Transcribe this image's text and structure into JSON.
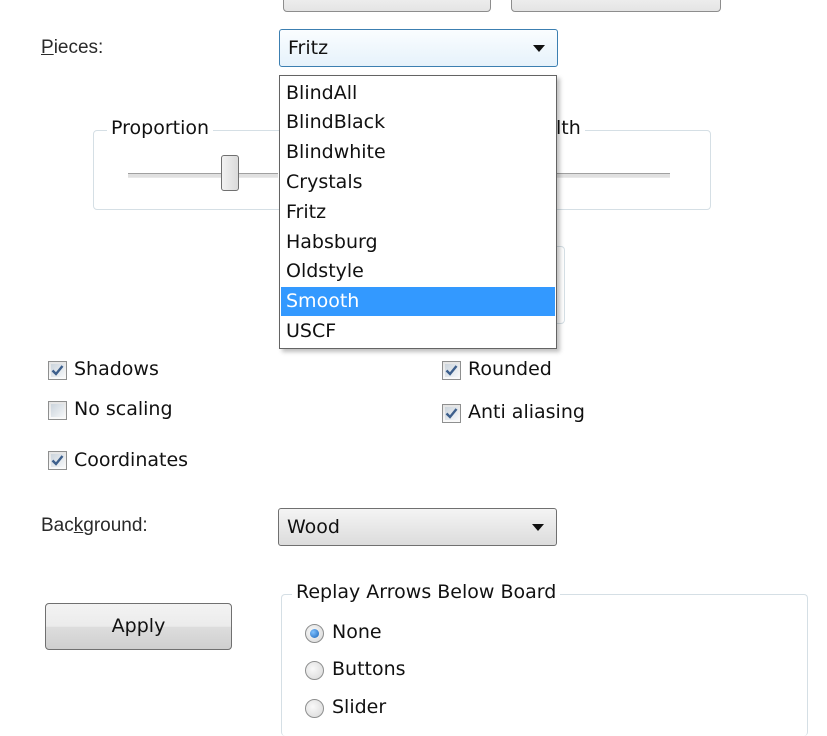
{
  "pieces": {
    "label_prefix": "P",
    "label_rest": "ieces:",
    "selected": "Fritz",
    "options": [
      "BlindAll",
      "BlindBlack",
      "Blindwhite",
      "Crystals",
      "Fritz",
      "Habsburg",
      "Oldstyle",
      "Smooth",
      "USCF"
    ],
    "highlighted": "Smooth"
  },
  "proportion": {
    "title": "Proportion",
    "right_title_fragment": "lth"
  },
  "checkboxes": {
    "shadows": {
      "label": "Shadows",
      "checked": true
    },
    "no_scaling": {
      "label": "No scaling",
      "checked": false
    },
    "coordinates": {
      "label": "Coordinates",
      "checked": true
    },
    "rounded": {
      "label": "Rounded",
      "checked": true
    },
    "anti_aliasing": {
      "label": "Anti aliasing",
      "checked": true
    }
  },
  "background": {
    "label_prefix": "Bac",
    "label_mnemonic": "k",
    "label_rest": "ground:",
    "selected": "Wood"
  },
  "apply_label": "Apply",
  "replay_arrows": {
    "title": "Replay Arrows Below Board",
    "options": [
      "None",
      "Buttons",
      "Slider"
    ],
    "selected": "None"
  },
  "colors": {
    "highlight": "#3399ff",
    "focus_border": "#3c7fb1",
    "radio_dot": "#1a64b8"
  }
}
